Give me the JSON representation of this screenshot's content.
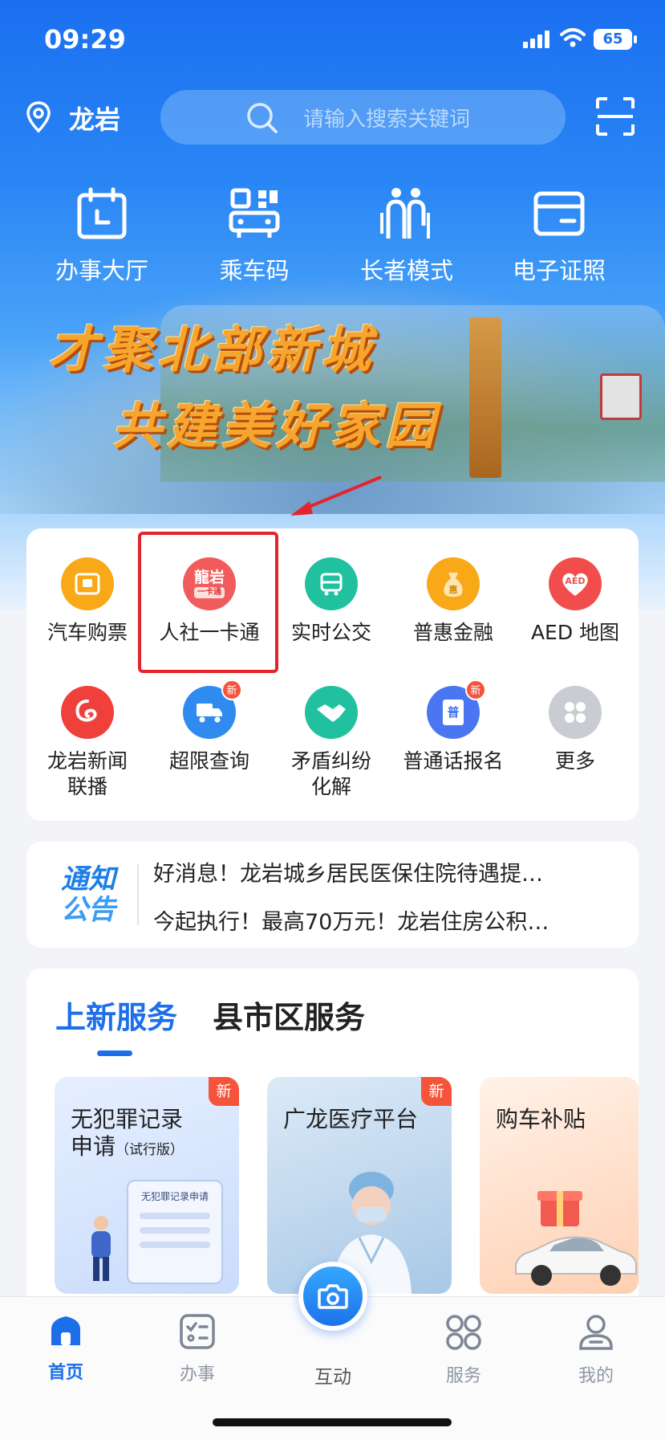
{
  "status_bar": {
    "time": "09:29",
    "battery": "65"
  },
  "header": {
    "location": "龙岩",
    "search_placeholder": "请输入搜索关键词"
  },
  "quick_actions": [
    {
      "label": "办事大厅",
      "icon": "calendar-icon"
    },
    {
      "label": "乘车码",
      "icon": "bus-code-icon"
    },
    {
      "label": "长者模式",
      "icon": "elderly-icon"
    },
    {
      "label": "电子证照",
      "icon": "card-icon"
    }
  ],
  "banner": {
    "line1": "才聚北部新城",
    "line2": "共建美好家园"
  },
  "services": [
    {
      "label": "汽车购票",
      "icon": "ticket-icon",
      "color": "#f9a818"
    },
    {
      "label": "人社一卡通",
      "icon": "social-card-icon",
      "color": "#f25b5b",
      "icon_text": "龍岩",
      "icon_sub": "一卡通"
    },
    {
      "label": "实时公交",
      "icon": "bus-icon",
      "color": "#21c1a0"
    },
    {
      "label": "普惠金融",
      "icon": "money-bag-icon",
      "color": "#f9a818"
    },
    {
      "label": "AED 地图",
      "icon": "aed-heart-icon",
      "color": "#f24d4d",
      "icon_text": "AED"
    },
    {
      "label": "龙岩新闻\n联播",
      "icon": "news-logo-icon",
      "color": "#f0403c"
    },
    {
      "label": "超限查询",
      "icon": "truck-icon",
      "color": "#2f8bf0",
      "badge": "新"
    },
    {
      "label": "矛盾纠纷\n化解",
      "icon": "handshake-icon",
      "color": "#21c1a0"
    },
    {
      "label": "普通话报名",
      "icon": "book-icon",
      "color": "#4a76f2",
      "badge": "新",
      "icon_text": "普"
    },
    {
      "label": "更多",
      "icon": "more-grid-icon",
      "color": "#c9ccd2"
    }
  ],
  "notice": {
    "logo_line1": "通知",
    "logo_line2": "公告",
    "items": [
      "好消息！龙岩城乡居民医保住院待遇提…",
      "今起执行！最高70万元！龙岩住房公积…"
    ]
  },
  "new_services": {
    "tab_active": "上新服务",
    "tab_inactive": "县市区服务",
    "tiles": [
      {
        "title": "无犯罪记录",
        "title2": "申请",
        "small": "（试行版）",
        "badge": "新",
        "doc_label": "无犯罪记录申请"
      },
      {
        "title": "广龙医疗平台",
        "badge": "新"
      },
      {
        "title": "购车补贴"
      }
    ]
  },
  "tabbar": {
    "items": [
      {
        "label": "首页",
        "icon": "home-icon"
      },
      {
        "label": "办事",
        "icon": "checklist-icon"
      },
      {
        "label": "互动",
        "icon": "camera-icon"
      },
      {
        "label": "服务",
        "icon": "apps-icon"
      },
      {
        "label": "我的",
        "icon": "profile-icon"
      }
    ]
  },
  "colors": {
    "accent": "#1c6fe9",
    "highlight_box": "#e5232b",
    "badge": "#f4543a"
  }
}
